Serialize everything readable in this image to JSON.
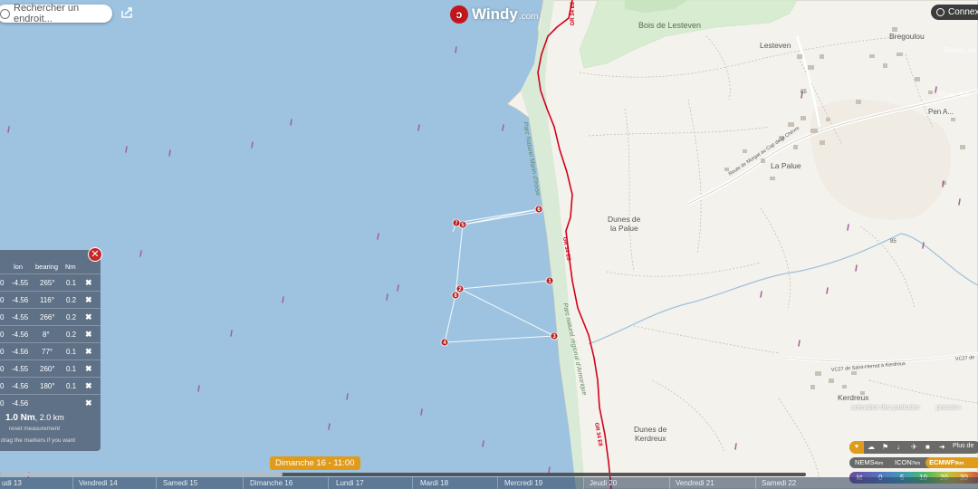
{
  "search": {
    "placeholder": "Rechercher un endroit..."
  },
  "logo": {
    "name": "Windy",
    "suffix": ".com"
  },
  "login": {
    "label": "Connexion"
  },
  "map_labels": {
    "bois": "Bois de Lesteven",
    "lesteven": "Lesteven",
    "bregoulou": "Bregoulou",
    "la_palue": "La Palue",
    "dunes_palue_1": "Dunes de",
    "dunes_palue_2": "la Palue",
    "dunes_kerdreux_1": "Dunes de",
    "dunes_kerdreux_2": "Kerdreux",
    "kerdreux": "Kerdreux",
    "pen_a": "Pen A...",
    "radar": "Radar, sa",
    "pluie": "Pluie, Ton",
    "route_morgat": "Route de Morgat au Cap de la Chèvre",
    "vc27": "VC27 de Saint-Hernot à Kerdreux",
    "vc27b": "VC27 de",
    "gr_1": "GR 34 E8",
    "gr_2": "GR 34 E8",
    "gr_3": "GR 34 E8",
    "gr_4": "GR 34 E8",
    "parc_1": "Parc Naturel Marin d'Iroise",
    "parc_2": "Parc naturel régional d'Armorique",
    "road_85_a": "85",
    "road_85_b": "85"
  },
  "markers": [
    "1",
    "2",
    "3",
    "4",
    "5",
    "6",
    "7",
    "8"
  ],
  "measure": {
    "headers": [
      "lon",
      "bearing",
      "Nm"
    ],
    "rows": [
      {
        "lat": "0",
        "lon": "-4.55",
        "bearing": "265°",
        "nm": "0.1"
      },
      {
        "lat": "0",
        "lon": "-4.56",
        "bearing": "116°",
        "nm": "0.2"
      },
      {
        "lat": "0",
        "lon": "-4.55",
        "bearing": "266°",
        "nm": "0.2"
      },
      {
        "lat": "0",
        "lon": "-4.56",
        "bearing": "8°",
        "nm": "0.2"
      },
      {
        "lat": "0",
        "lon": "-4.56",
        "bearing": "77°",
        "nm": "0.1"
      },
      {
        "lat": "0",
        "lon": "-4.55",
        "bearing": "260°",
        "nm": "0.1"
      },
      {
        "lat": "0",
        "lon": "-4.56",
        "bearing": "180°",
        "nm": "0.1"
      },
      {
        "lat": "0",
        "lon": "-4.56",
        "bearing": "",
        "nm": ""
      }
    ],
    "total_nm": "1.0 Nm",
    "total_km": ", 2.0 km",
    "reset": "reset measurement",
    "drag": "drag the markers if you want"
  },
  "timeline": {
    "current": "Dimanche 16 - 11:00",
    "progress": 0.35,
    "days": [
      "udi 13",
      "Vendredi 14",
      "Samedi 15",
      "Dimanche 16",
      "Lundi 17",
      "Mardi 18",
      "Mercredi 19",
      "Jeudi 20",
      "Vendredi 21",
      "Samedi 22"
    ]
  },
  "controls": {
    "animation": "animation des particules",
    "pressure": "pression",
    "more": "Plus de"
  },
  "models": {
    "nems": "NEMS",
    "nems_res": "4km",
    "icon": "ICON",
    "icon_res": "7km",
    "ecmwf": "ECMWF",
    "ecmwf_res": "9km",
    "selected": "ECMWF"
  },
  "scale": {
    "unit": "kt",
    "values": [
      "0",
      "5",
      "10",
      "20",
      "30"
    ]
  },
  "colors": {
    "sea": "#9dc3e0",
    "land": "#f4f2ec",
    "forest": "#d7ecd0",
    "trail": "#d0021b",
    "accent": "#e09b1a",
    "close": "#c62828"
  }
}
